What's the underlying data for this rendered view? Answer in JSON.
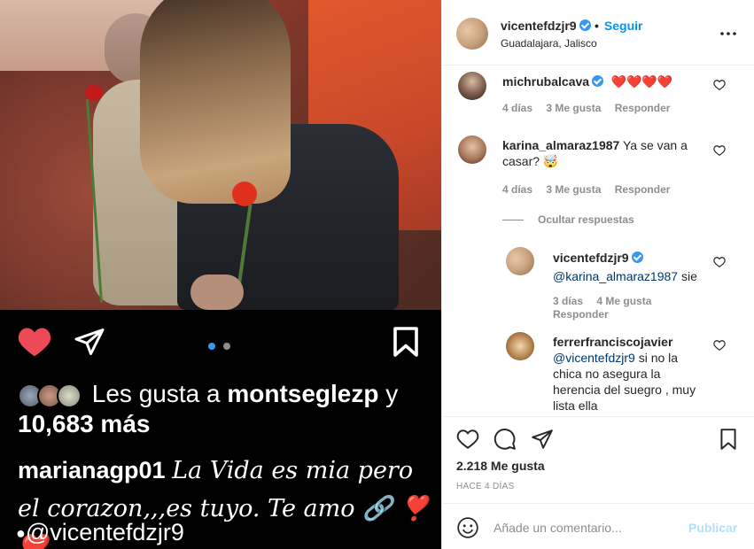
{
  "post": {
    "likes_text_prefix": "Les gusta a",
    "likes_user": "montseglezp",
    "likes_suffix": "y",
    "likes_others": "10,683 más",
    "caption_user": "marianagp01",
    "caption_text": "La Vida es mia pero el corazon,,,es tuyo. Te amo 🔗 ❣️ ❤️",
    "mention": "@vicentefdzjr9",
    "carousel_active_color": "#3897f0",
    "carousel_inactive_color": "#8e8e8e",
    "liked_color": "#ed4956"
  },
  "header": {
    "username": "vicentefdzjr9",
    "separator": "•",
    "follow_label": "Seguir",
    "location": "Guadalajara, Jalisco",
    "more_icon": "more-options-icon"
  },
  "comments": [
    {
      "user": "michrubalcava",
      "verified": true,
      "text": "❤️❤️❤️❤️",
      "time": "4 días",
      "likes": "3 Me gusta",
      "reply": "Responder"
    },
    {
      "user": "karina_almaraz1987",
      "verified": false,
      "text": "Ya se van a casar? 🤯",
      "time": "4 días",
      "likes": "3 Me gusta",
      "reply": "Responder"
    }
  ],
  "hide_replies_label": "Ocultar respuestas",
  "replies": [
    {
      "user": "vicentefdzjr9",
      "verified": true,
      "mention": "@karina_almaraz1987",
      "text": "sie",
      "time": "3 días",
      "likes": "4 Me gusta",
      "reply": "Responder"
    },
    {
      "user": "ferrerfranciscojavier",
      "verified": false,
      "mention": "@vicentefdzjr9",
      "text": "si no la chica no asegura la herencia del suegro , muy lista ella"
    }
  ],
  "footer": {
    "likes_count": "2.218 Me gusta",
    "time_ago": "HACE 4 DÍAS",
    "comment_placeholder": "Añade un comentario...",
    "publish_label": "Publicar"
  }
}
